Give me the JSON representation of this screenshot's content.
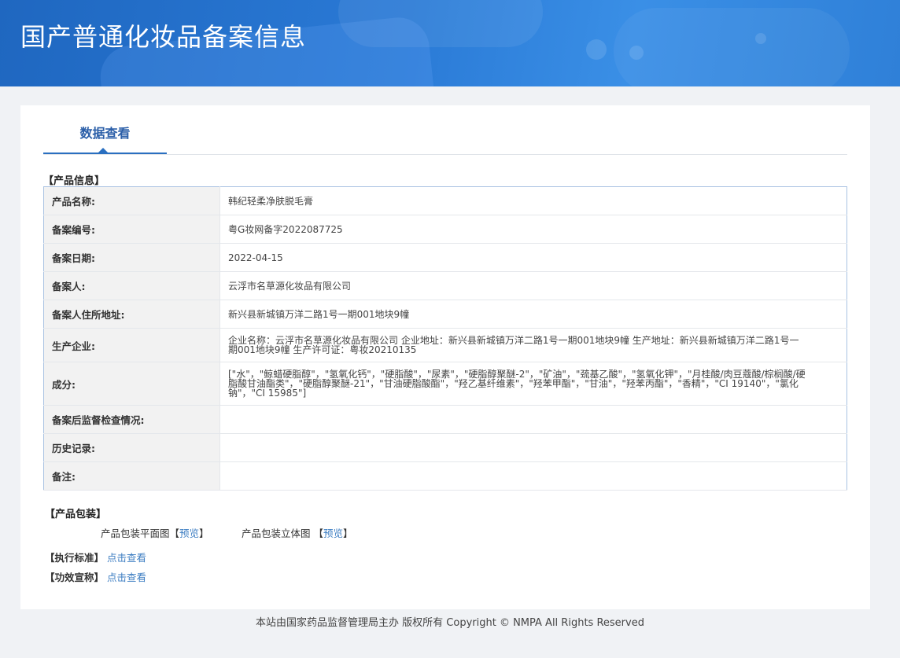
{
  "header": {
    "title": "国产普通化妆品备案信息"
  },
  "tabs": [
    {
      "label": "数据查看"
    }
  ],
  "product_info": {
    "section_title": "【产品信息】",
    "rows": [
      {
        "label": "产品名称:",
        "value": "韩纪轻柔净肤脱毛膏"
      },
      {
        "label": "备案编号:",
        "value": "粤G妆网备字2022087725"
      },
      {
        "label": "备案日期:",
        "value": "2022-04-15"
      },
      {
        "label": "备案人:",
        "value": "云浮市名草源化妆品有限公司"
      },
      {
        "label": "备案人住所地址:",
        "value": "新兴县新城镇万洋二路1号一期001地块9幢"
      },
      {
        "label": "生产企业:",
        "value": "企业名称：云浮市名草源化妆品有限公司 企业地址：新兴县新城镇万洋二路1号一期001地块9幢 生产地址：新兴县新城镇万洋二路1号一期001地块9幢 生产许可证：粤妆20210135"
      },
      {
        "label": "成分:",
        "value": "[\"水\"，\"鲸蜡硬脂醇\"，\"氢氧化钙\"，\"硬脂酸\"，\"尿素\"，\"硬脂醇聚醚-2\"，\"矿油\"，\"巯基乙酸\"，\"氢氧化钾\"，\"月桂酸/肉豆蔻酸/棕榈酸/硬脂酸甘油酯类\"，\"硬脂醇聚醚-21\"，\"甘油硬脂酸酯\"，\"羟乙基纤维素\"，\"羟苯甲酯\"，\"甘油\"，\"羟苯丙酯\"，\"香精\"，\"CI 19140\"，\"氯化钠\"，\"CI 15985\"]"
      },
      {
        "label": "备案后监督检查情况:",
        "value": ""
      },
      {
        "label": "历史记录:",
        "value": ""
      },
      {
        "label": "备注:",
        "value": ""
      }
    ]
  },
  "packaging": {
    "section_title": "【产品包装】",
    "flat_label": "产品包装平面图",
    "flat_link": "预览",
    "solid_label": "产品包装立体图",
    "solid_link": "预览"
  },
  "standard": {
    "label": "【执行标准】",
    "link": "点击查看"
  },
  "efficacy": {
    "label": "【功效宣称】",
    "link": "点击查看"
  },
  "footer": {
    "text": "本站由国家药品监督管理局主办 版权所有 Copyright © NMPA All Rights Reserved"
  }
}
